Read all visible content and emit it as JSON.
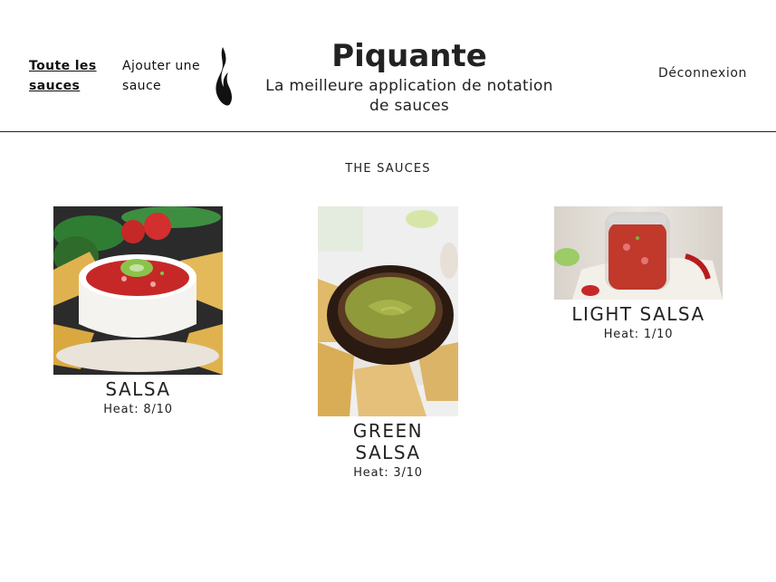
{
  "nav": {
    "all_sauces": "Toute les sauces",
    "add_sauce": "Ajouter une sauce",
    "logout": "Déconnexion"
  },
  "brand": {
    "title": "Piquante",
    "subtitle": "La meilleure application de notation de sauces"
  },
  "section": {
    "title": "THE SAUCES"
  },
  "sauces": [
    {
      "name": "SALSA",
      "heat": "Heat: 8/10"
    },
    {
      "name": "GREEN SALSA",
      "heat": "Heat: 3/10"
    },
    {
      "name": "LIGHT SALSA",
      "heat": "Heat: 1/10"
    }
  ],
  "colors": {
    "text": "#222222",
    "divider": "#222222",
    "background": "#ffffff"
  },
  "icons": {
    "logo": "flame-icon"
  }
}
